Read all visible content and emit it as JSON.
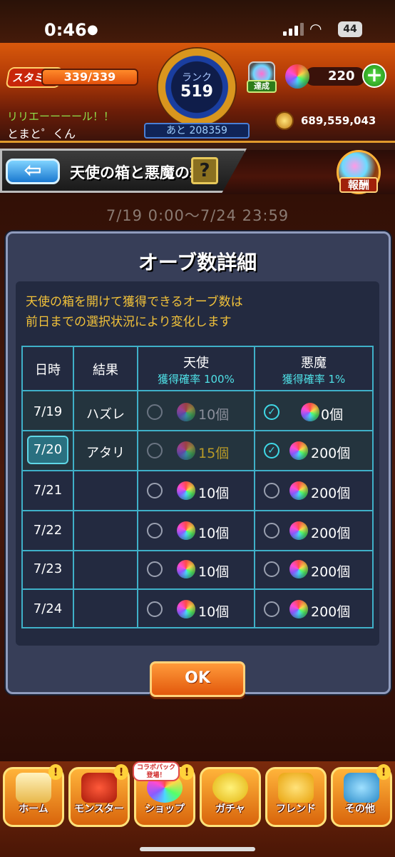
{
  "status_bar": {
    "time": "0:46",
    "battery": "44"
  },
  "header": {
    "stamina_label": "スタミナ",
    "stamina_value": "339/339",
    "rank_label": "ランク",
    "rank_value": "519",
    "rank_remaining": "あと 208359",
    "achievement_label": "達成",
    "orb_count": "220",
    "plus": "+",
    "player_message": "リリエーーーール！！",
    "player_name": "とまと゜くん",
    "coins": "689,559,043"
  },
  "titlebar": {
    "back": "⇦",
    "title": "天使の箱と悪魔の箱",
    "help": "?",
    "reward_label": "報酬"
  },
  "period": "7/19 0:00〜7/24 23:59",
  "modal": {
    "title": "オーブ数詳細",
    "note_line1": "天使の箱を開けて獲得できるオーブ数は",
    "note_line2": "前日までの選択状況により変化します",
    "headers": {
      "date": "日時",
      "result": "結果",
      "angel": "天使",
      "angel_rate": "獲得確率 100%",
      "devil": "悪魔",
      "devil_rate": "獲得確率 1%"
    },
    "rows": [
      {
        "date": "7/19",
        "result": "ハズレ",
        "angel_count": "10個",
        "devil_count": "0個"
      },
      {
        "date": "7/20",
        "result": "アタリ",
        "angel_count": "15個",
        "devil_count": "200個"
      },
      {
        "date": "7/21",
        "result": "",
        "angel_count": "10個",
        "devil_count": "200個"
      },
      {
        "date": "7/22",
        "result": "",
        "angel_count": "10個",
        "devil_count": "200個"
      },
      {
        "date": "7/23",
        "result": "",
        "angel_count": "10個",
        "devil_count": "200個"
      },
      {
        "date": "7/24",
        "result": "",
        "angel_count": "10個",
        "devil_count": "200個"
      }
    ],
    "ok_label": "OK"
  },
  "bottom_nav": {
    "home": "ホーム",
    "monster": "モンスター",
    "shop": "ショップ",
    "gacha": "ガチャ",
    "friend": "フレンド",
    "other": "その他",
    "collab_badge": "コラボパック登場！",
    "badge": "!"
  },
  "colors": {
    "table_border": "#3fb0c8",
    "note_text": "#f2c23a",
    "rate_text": "#4fe0e6",
    "ok_button": "#e2580c"
  }
}
